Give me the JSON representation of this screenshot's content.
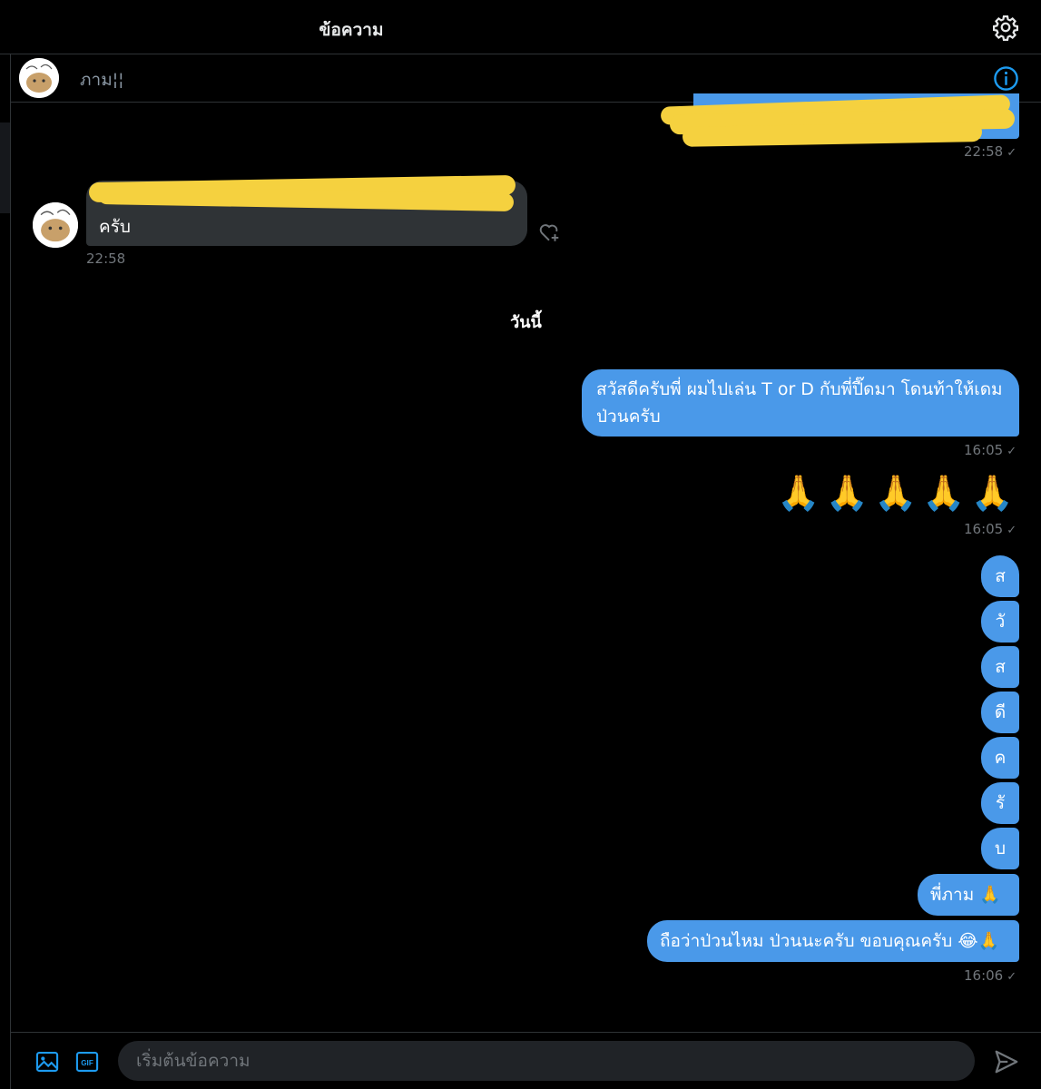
{
  "header": {
    "title": "ข้อความ",
    "settings_icon": "gear-icon"
  },
  "conversation": {
    "name": "ภาม¦¦",
    "info_icon": "info-icon"
  },
  "messages": {
    "out_old": {
      "time": "22:58",
      "status": "✓"
    },
    "in_old": {
      "visible_text": "ครับ",
      "time": "22:58",
      "reaction_icon": "heart-plus-icon"
    },
    "day_separator": "วันนี้",
    "out1": {
      "line1": "สวัสดีครับพี่ ผมไปเล่น T or D กับพี่ปี๊ดมา โดนท้าให้เดม",
      "line2": "ป่วนครับ",
      "time": "16:05",
      "status": "✓"
    },
    "out2": {
      "text": "🙏🙏🙏🙏🙏",
      "time": "16:05",
      "status": "✓"
    },
    "letters": [
      "ส",
      "วั",
      "ส",
      "ดี",
      "ค",
      "รั",
      "บ"
    ],
    "out3": {
      "text": "พี่ภาม 🙏"
    },
    "out4": {
      "text": "ถือว่าป่วนไหม ป่วนนะครับ ขอบคุณครับ 😂🙏",
      "time": "16:06",
      "status": "✓"
    }
  },
  "composer": {
    "placeholder": "เริ่มต้นข้อความ",
    "image_icon": "image-icon",
    "gif_label": "GIF",
    "send_icon": "send-icon"
  },
  "colors": {
    "accent": "#1d9bf0",
    "bubble_out": "#4a99e9",
    "bubble_in": "#2f3336",
    "redaction": "#f5d13f"
  }
}
